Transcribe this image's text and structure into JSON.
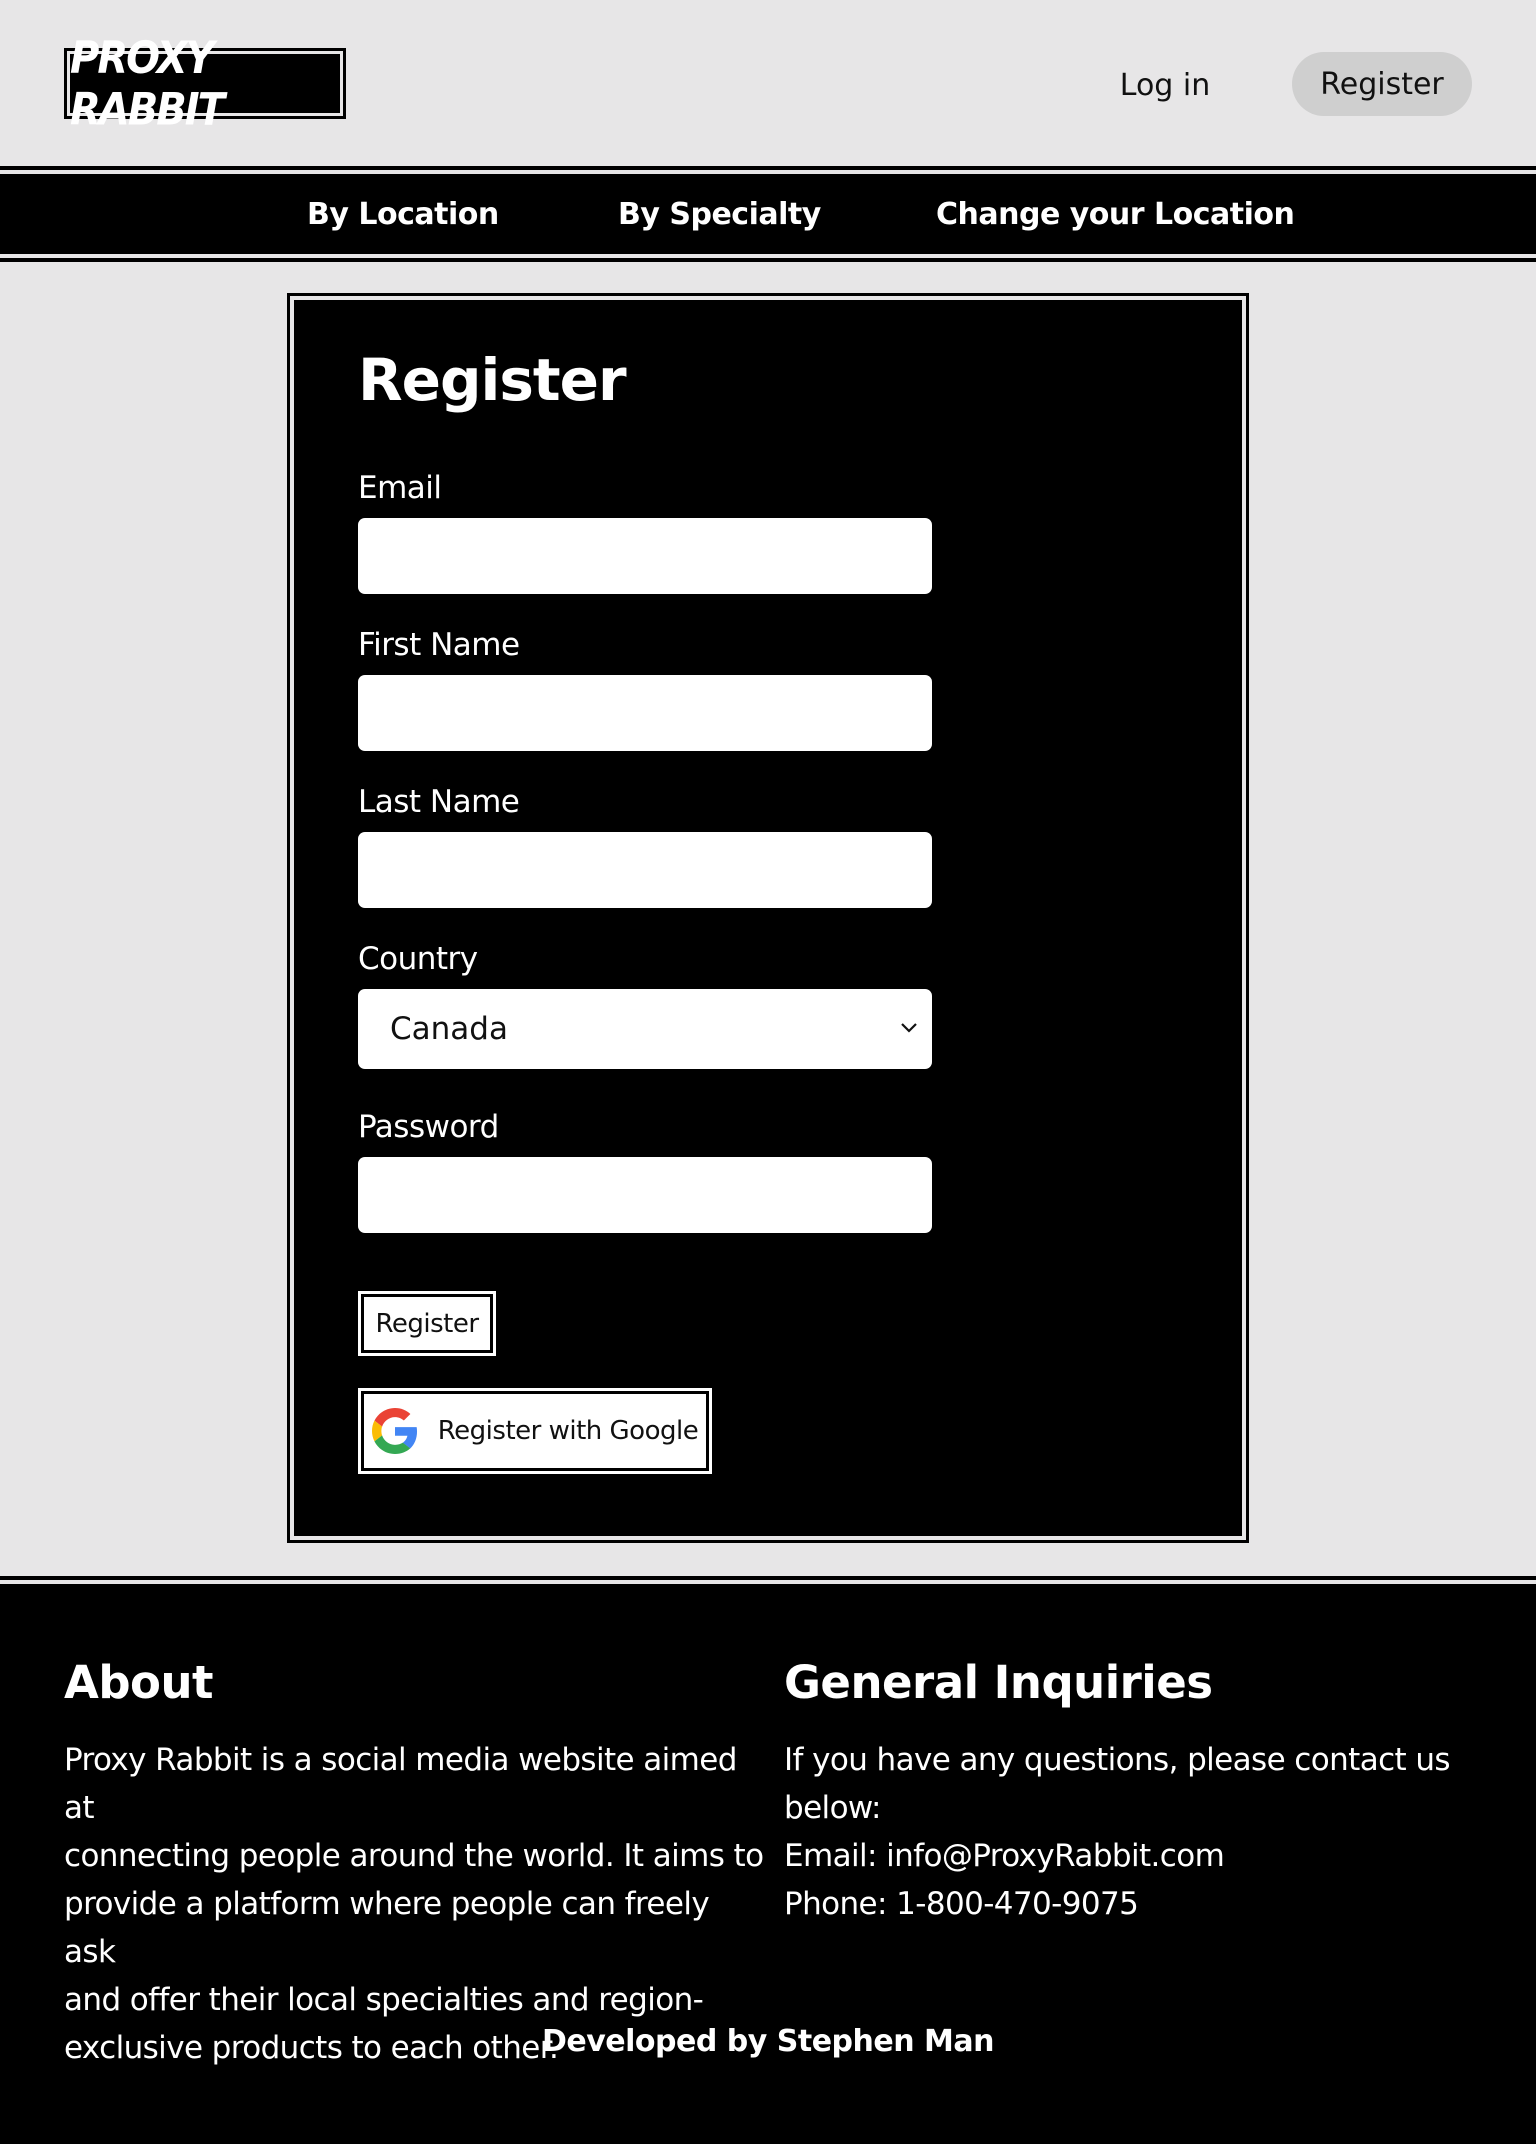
{
  "header": {
    "logo_text": "PROXY RABBIT",
    "login_label": "Log in",
    "register_label": "Register"
  },
  "nav": {
    "items": [
      {
        "label": "By Location"
      },
      {
        "label": "By Specialty"
      },
      {
        "label": "Change your Location"
      }
    ]
  },
  "form": {
    "title": "Register",
    "email_label": "Email",
    "email_value": "",
    "first_name_label": "First Name",
    "first_name_value": "",
    "last_name_label": "Last Name",
    "last_name_value": "",
    "country_label": "Country",
    "country_selected": "Canada",
    "password_label": "Password",
    "password_value": "",
    "submit_label": "Register",
    "google_label": "Register with Google"
  },
  "footer": {
    "about_heading": "About",
    "about_lines": [
      "Proxy Rabbit is a social media website aimed at",
      "connecting people around the world. It aims to",
      "provide a platform where people can freely ask",
      "and offer their local specialties and region-",
      "exclusive products to each other."
    ],
    "inquiries_heading": "General Inquiries",
    "inquiries_lines": [
      "If you have any questions, please contact us below:",
      "Email: info@ProxyRabbit.com",
      "Phone: 1-800-470-9075"
    ],
    "credit": "Developed by Stephen Man"
  },
  "colors": {
    "background": "#e7e6e7",
    "primary": "#000000",
    "pill": "#cfcfcf",
    "text_on_dark": "#ffffff"
  },
  "icons": {
    "google": "google-g-icon",
    "select_arrow": "chevron-down-icon"
  }
}
